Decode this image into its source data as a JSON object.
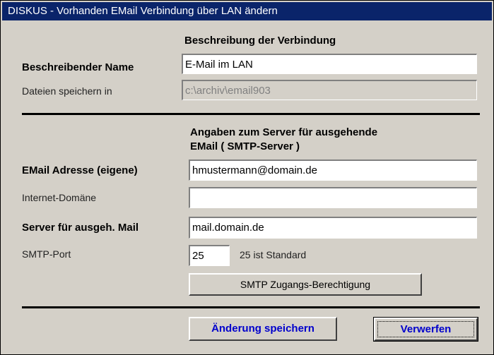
{
  "window": {
    "title": "DISKUS - Vorhanden EMail Verbindung über LAN ändern"
  },
  "section_connection": {
    "heading": "Beschreibung der Verbindung",
    "name_label": "Beschreibender Name",
    "name_value": "E-Mail im LAN",
    "folder_label": "Dateien speichern in",
    "folder_value": "c:\\archiv\\email903"
  },
  "section_server": {
    "heading_line1": "Angaben zum Server für ausgehende",
    "heading_line2": "EMail ( SMTP-Server )",
    "email_label": "EMail Adresse (eigene)",
    "email_value": "hmustermann@domain.de",
    "domain_label": "Internet-Domäne",
    "domain_value": "",
    "server_label": "Server für ausgeh. Mail",
    "server_value": "mail.domain.de",
    "port_label": "SMTP-Port",
    "port_value": "25",
    "port_hint": "25 ist Standard",
    "auth_button": "SMTP Zugangs-Berechtigung"
  },
  "footer": {
    "save_button": "Änderung speichern",
    "discard_button": "Verwerfen"
  },
  "colors": {
    "titlebar": "#0a246a",
    "dialog_bg": "#d4d0c8",
    "link_text": "#0000cc"
  }
}
